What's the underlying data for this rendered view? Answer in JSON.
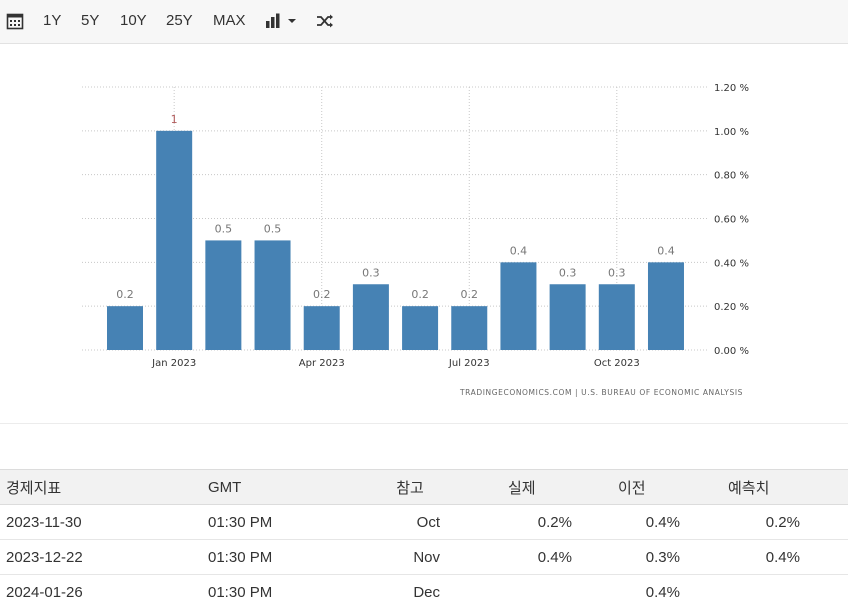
{
  "toolbar": {
    "ranges": [
      "1Y",
      "5Y",
      "10Y",
      "25Y",
      "MAX"
    ]
  },
  "chart_data": {
    "type": "bar",
    "categories": [
      "2022-12",
      "2023-01",
      "2023-02",
      "2023-03",
      "2023-04",
      "2023-05",
      "2023-06",
      "2023-07",
      "2023-08",
      "2023-09",
      "2023-10",
      "2023-11"
    ],
    "values": [
      0.2,
      1,
      0.5,
      0.5,
      0.2,
      0.3,
      0.2,
      0.2,
      0.4,
      0.3,
      0.3,
      0.4
    ],
    "data_labels": [
      "0.2",
      "1",
      "0.5",
      "0.5",
      "0.2",
      "0.3",
      "0.2",
      "0.2",
      "0.4",
      "0.3",
      "0.3",
      "0.4"
    ],
    "x_ticks": [
      {
        "index": 1,
        "label": "Jan 2023"
      },
      {
        "index": 4,
        "label": "Apr 2023"
      },
      {
        "index": 7,
        "label": "Jul 2023"
      },
      {
        "index": 10,
        "label": "Oct 2023"
      }
    ],
    "y_ticks": [
      {
        "value": 1.2,
        "label": "1.20 %"
      },
      {
        "value": 1.0,
        "label": "1.00 %"
      },
      {
        "value": 0.8,
        "label": "0.80 %"
      },
      {
        "value": 0.6,
        "label": "0.60 %"
      },
      {
        "value": 0.4,
        "label": "0.40 %"
      },
      {
        "value": 0.2,
        "label": "0.20 %"
      },
      {
        "value": 0.0,
        "label": "0.00 %"
      }
    ],
    "ylim": [
      0,
      1.2
    ],
    "grid": true,
    "y_axis_side": "right",
    "bar_color": "#4682b4",
    "highlight_label_color": "#b05a5a",
    "source": "TRADINGECONOMICS.COM  |  U.S. BUREAU OF ECONOMIC ANALYSIS"
  },
  "calendar": {
    "headers": [
      "경제지표",
      "GMT",
      "참고",
      "실제",
      "이전",
      "예측치"
    ],
    "rows": [
      [
        "2023-11-30",
        "01:30 PM",
        "Oct",
        "0.2%",
        "0.4%",
        "0.2%"
      ],
      [
        "2023-12-22",
        "01:30 PM",
        "Nov",
        "0.4%",
        "0.3%",
        "0.4%"
      ],
      [
        "2024-01-26",
        "01:30 PM",
        "Dec",
        "",
        "0.4%",
        ""
      ]
    ]
  }
}
